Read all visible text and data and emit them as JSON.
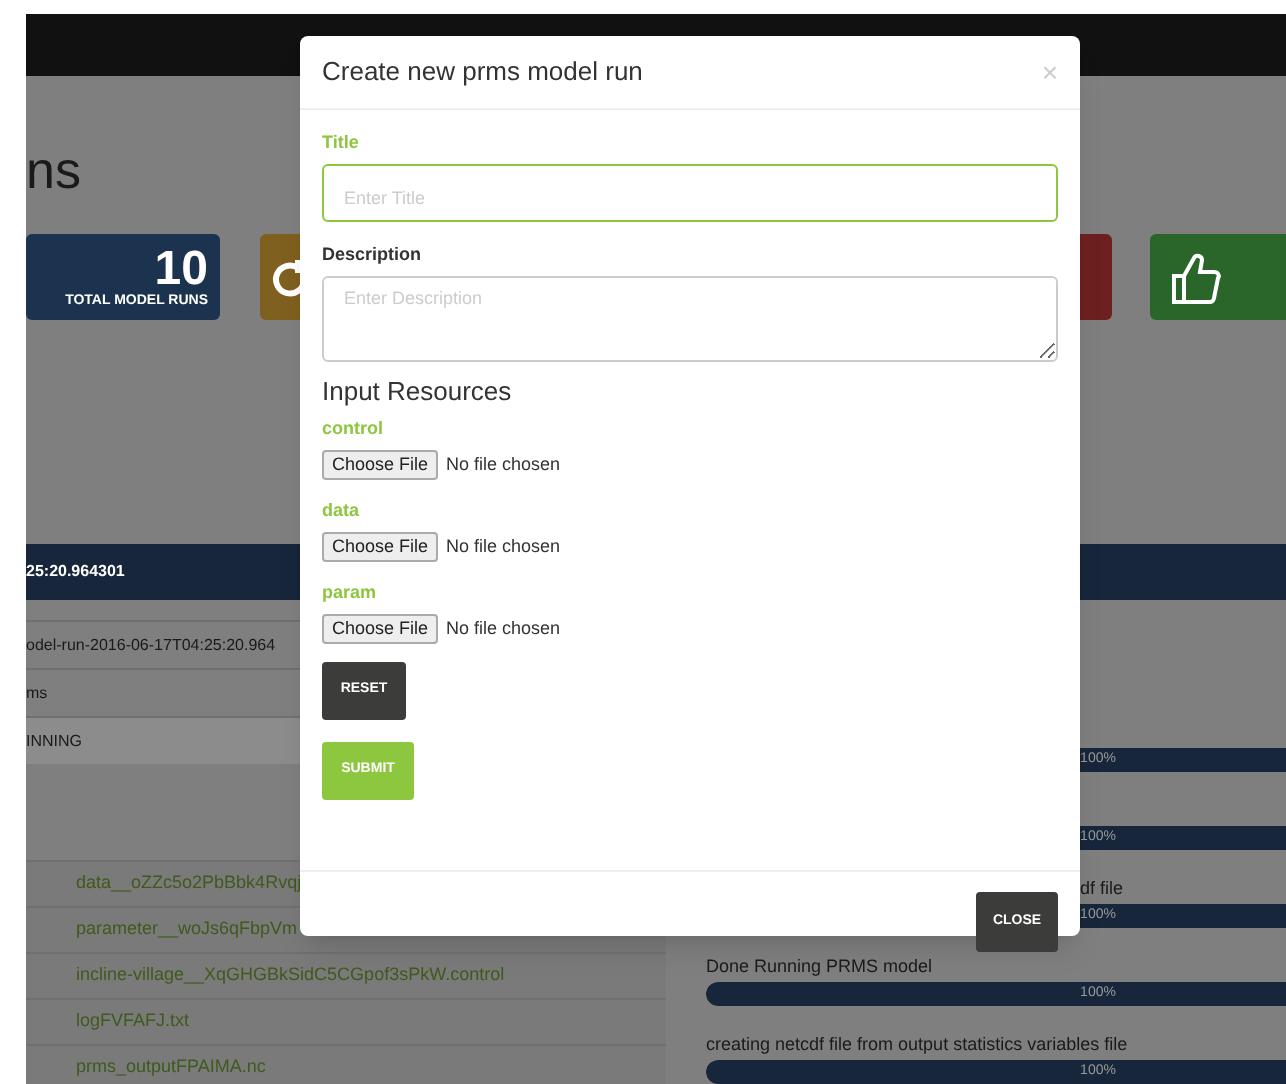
{
  "page": {
    "heading": "ns",
    "stat_cards": [
      {
        "kind": "count",
        "color": "#1c3350",
        "value": "10",
        "label": "TOTAL MODEL RUNS"
      },
      {
        "kind": "icon",
        "color": "#80601f"
      },
      {
        "kind": "plain",
        "color": "#6e2020"
      },
      {
        "kind": "thumb",
        "color": "#2a662a"
      }
    ],
    "run_header": "25:20.964301",
    "run_rows": [
      {
        "text": "odel-run-2016-06-17T04:25:20.964",
        "striped": false
      },
      {
        "text": "ms",
        "striped": false
      },
      {
        "text": "INNING",
        "striped": true
      }
    ],
    "files": [
      "data__oZZc5o2PbBbk4Rvqj",
      "parameter__woJs6qFbpVm",
      "incline-village__XqGHGBkSidC5CGpof3sPkW.control",
      "logFVFAFJ.txt",
      "prms_outputFPAIMA.nc"
    ],
    "progress": [
      {
        "level": 1,
        "reading": "100%"
      },
      {
        "level": 1,
        "reading": "100%"
      },
      {
        "label": "df file",
        "level": 1,
        "reading": "100%"
      },
      {
        "label": "Done Running PRMS model",
        "level": 1,
        "reading": "100%"
      },
      {
        "label": "creating netcdf file from output statistics variables file",
        "level": 1,
        "reading": "100%"
      }
    ]
  },
  "modal": {
    "title": "Create new prms model run",
    "close_icon": "×",
    "fields": [
      {
        "kind": "input",
        "label": "Title",
        "placeholder": "Enter Title",
        "focused": true
      },
      {
        "kind": "textarea",
        "label": "Description",
        "placeholder": "Enter Description",
        "focused": false
      }
    ],
    "section": "Input Resources",
    "files": [
      {
        "label": "control",
        "button": "Choose File",
        "status": "No file chosen"
      },
      {
        "label": "data",
        "button": "Choose File",
        "status": "No file chosen"
      },
      {
        "label": "param",
        "button": "Choose File",
        "status": "No file chosen"
      }
    ],
    "buttons": [
      {
        "kind": "reset",
        "label": "RESET"
      },
      {
        "kind": "submit",
        "label": "SUBMIT"
      }
    ],
    "footer_button": "CLOSE"
  }
}
